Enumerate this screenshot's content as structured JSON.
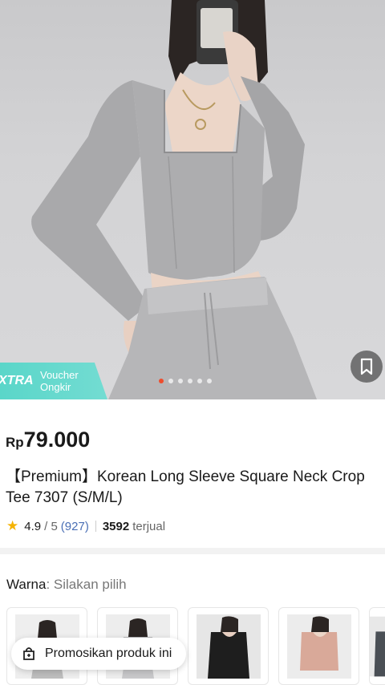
{
  "hero": {
    "voucher_extra": "XTRA",
    "voucher_line1": "Voucher",
    "voucher_line2": "Ongkir",
    "image_count": 6,
    "active_index": 0,
    "accent_color": "#ee4d2d",
    "voucher_color": "#5ad6c9"
  },
  "product": {
    "currency": "Rp",
    "price": "79.000",
    "title": "【Premium】Korean Long Sleeve Square Neck Crop Tee 7307 (S/M/L)",
    "rating": "4.9",
    "rating_max": "/ 5",
    "rating_count": "(927)",
    "sold_count": "3592",
    "sold_label": "terjual"
  },
  "variants": {
    "label": "Warna",
    "hint": ": Silakan pilih",
    "options": [
      "white-grey",
      "light-grey",
      "black",
      "pink",
      "dark"
    ]
  },
  "promo": {
    "label": "Promosikan produk ini"
  },
  "icons": {
    "bookmark": "bookmark-icon",
    "star": "star-icon",
    "promo": "share-bag-icon"
  }
}
